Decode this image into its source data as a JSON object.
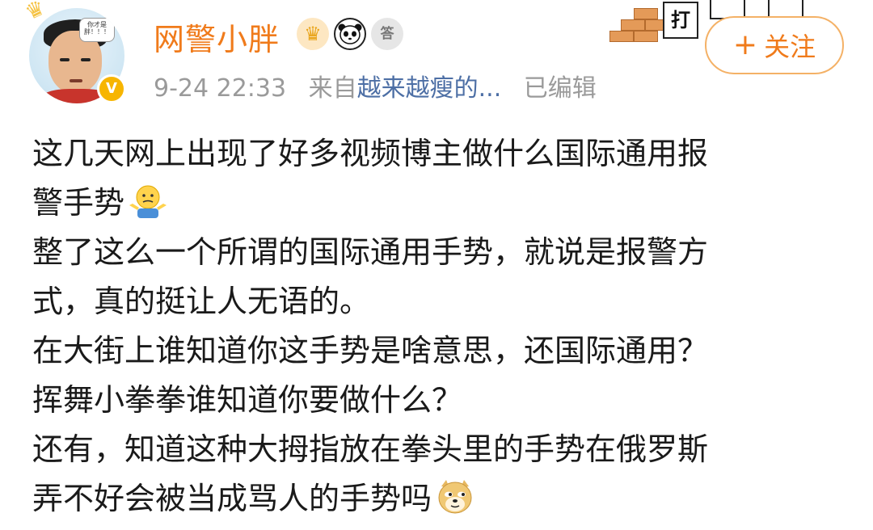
{
  "post": {
    "author": {
      "name": "网警小胖",
      "avatar_bubble": "你才是胖！！！",
      "verified_mark": "V"
    },
    "badges": [
      "vip-crown-icon",
      "panda-icon",
      "medal-icon"
    ],
    "medal_text": "答",
    "deco_char": "打",
    "timestamp": "9-24 22:33",
    "source_prefix": "来自",
    "source": "越来越瘦的...",
    "edited": "已编辑",
    "follow_label": "关注",
    "follow_plus": "+",
    "lines": {
      "l1": "这几天网上出现了好多视频博主做什么国际通用报",
      "l2": "警手势",
      "l3": "整了这么一个所谓的国际通用手势，就说是报警方",
      "l4": "式，真的挺让人无语的。",
      "l5": "在大街上谁知道你这手势是啥意思，还国际通用？",
      "l6": "挥舞小拳拳谁知道你要做什么？",
      "l7": "还有，知道这种大拇指放在拳头里的手势在俄罗斯",
      "l8": "弄不好会被当成骂人的手势吗"
    },
    "colors": {
      "username": "#f07b1b",
      "link": "#4d6fa5",
      "meta": "#9a9a9a",
      "follow_border": "#f4b166"
    }
  }
}
